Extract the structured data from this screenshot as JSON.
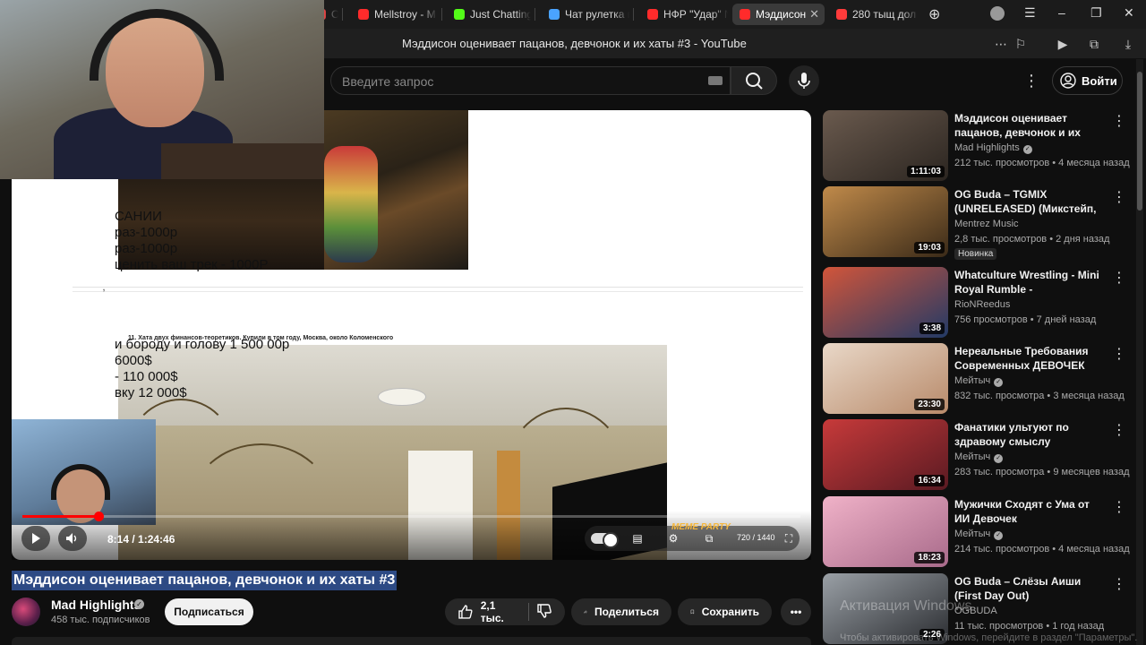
{
  "browser": {
    "tabs": [
      {
        "label": "От",
        "color": "#ff4a4a"
      },
      {
        "label": "Mellstroy - M",
        "color": "#ff2b2b"
      },
      {
        "label": "Just Chatting",
        "color": "#53fc18"
      },
      {
        "label": "Чат рулетка г",
        "color": "#4aa3ff"
      },
      {
        "label": "НФР \"Удар\" N",
        "color": "#ff2b2b"
      },
      {
        "label": "Мэддисон",
        "color": "#ff2b2b"
      },
      {
        "label": "280 тыщ дол",
        "color": "#ff3b3b"
      }
    ],
    "page_title": "Мэддисон оценивает пацанов, девчонок и их хаты #3 - YouTube"
  },
  "header": {
    "search_placeholder": "Введите запрос",
    "signin_label": "Войти"
  },
  "video": {
    "overlay_text_1": [
      "САНИИ",
      "раз-1000р",
      "раз-1000р",
      "ценить ваш трек - 1000Р"
    ],
    "doc_heading": "11. Хата двух финансов-теоретиков. Купили в том году, Москва, около Коломенского",
    "overlay_text_2": [
      "и бороду и голову 1 500 00р",
      "6000$",
      "- 110 000$",
      "вку 12 000$"
    ],
    "cursor_marker": "̓",
    "current_time": "8:14 / 1:24:46",
    "progress": 0.098,
    "quality": "720 / 1440",
    "watermark": "MEME PARTY"
  },
  "info": {
    "title": "Мэддисон оценивает пацанов, девчонок и их хаты #3",
    "channel": "Mad Highlights",
    "subscribers": "458 тыс. подписчиков",
    "subscribe_label": "Подписаться",
    "likes": "2,1 тыс.",
    "share_label": "Поделиться",
    "save_label": "Сохранить"
  },
  "recommendations": [
    {
      "title": "Мэддисон оценивает пацанов, девчонок и их хаты...",
      "channel": "Mad Highlights",
      "verified": true,
      "meta": "212 тыс. просмотров • 4 месяца назад",
      "duration": "1:11:03",
      "badge": "",
      "thumb": [
        "#6a5a4e",
        "#2b2520"
      ]
    },
    {
      "title": "OG Buda – TGMIX (UNRELEASED) (Микстейп, ...",
      "channel": "Mentrez Music",
      "verified": false,
      "meta": "2,8 тыс. просмотров • 2 дня назад",
      "duration": "19:03",
      "badge": "Новинка",
      "thumb": [
        "#c08a4a",
        "#3a2a18"
      ]
    },
    {
      "title": "Whatculture Wrestling - Mini Royal Rumble - (Unofficial/Not...",
      "channel": "RioNReedus",
      "verified": false,
      "meta": "756 просмотров • 7 дней назад",
      "duration": "3:38",
      "badge": "",
      "thumb": [
        "#d2553a",
        "#223a66"
      ]
    },
    {
      "title": "Нереальные Требования Современных ДЕВОЧЕК",
      "channel": "Мейтыч",
      "verified": true,
      "meta": "832 тыс. просмотра • 3 месяца назад",
      "duration": "23:30",
      "badge": "",
      "thumb": [
        "#e9d8c8",
        "#b88a6a"
      ]
    },
    {
      "title": "Фанатики ультуют по здравому смыслу",
      "channel": "Мейтыч",
      "verified": true,
      "meta": "283 тыс. просмотра • 9 месяцев назад",
      "duration": "16:34",
      "badge": "",
      "thumb": [
        "#c73a3a",
        "#5a1a22"
      ]
    },
    {
      "title": "Мужички Сходят с Ума от ИИ Девочек",
      "channel": "Мейтыч",
      "verified": true,
      "meta": "214 тыс. просмотров • 4 месяца назад",
      "duration": "18:23",
      "badge": "",
      "thumb": [
        "#f0b2c8",
        "#a86a8a"
      ]
    },
    {
      "title": "OG Buda – Слёзы Аиши (First Day Out)",
      "channel": "OGBUDA",
      "verified": false,
      "meta": "11 тыс. просмотров • 1 год назад",
      "duration": "2:26",
      "badge": "",
      "thumb": [
        "#9aa0a6",
        "#2a2c30"
      ]
    }
  ],
  "windows_notice": [
    "Активация Windows",
    "Чтобы активировать Windows, перейдите в раздел \"Параметры\"."
  ]
}
